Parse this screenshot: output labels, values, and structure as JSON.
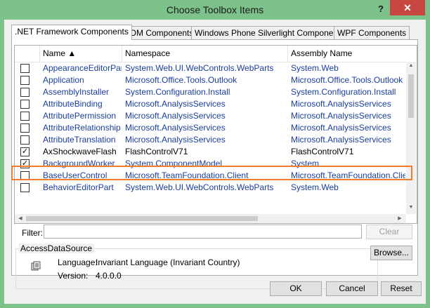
{
  "window": {
    "title": "Choose Toolbox Items",
    "help_label": "?",
    "close_label": "✕"
  },
  "tabs": [
    {
      "label": ".NET Framework Components",
      "active": true
    },
    {
      "label": "COM Components",
      "active": false
    },
    {
      "label": "Windows Phone Silverlight Components",
      "active": false
    },
    {
      "label": "WPF Components",
      "active": false
    }
  ],
  "table": {
    "columns": [
      "Name ▲",
      "Namespace",
      "Assembly Name"
    ],
    "rows": [
      {
        "checked": false,
        "name": "AppearanceEditorPart",
        "namespace": "System.Web.UI.WebControls.WebParts",
        "assembly": "System.Web"
      },
      {
        "checked": false,
        "name": "Application",
        "namespace": "Microsoft.Office.Tools.Outlook",
        "assembly": "Microsoft.Office.Tools.Outlook"
      },
      {
        "checked": false,
        "name": "AssemblyInstaller",
        "namespace": "System.Configuration.Install",
        "assembly": "System.Configuration.Install"
      },
      {
        "checked": false,
        "name": "AttributeBinding",
        "namespace": "Microsoft.AnalysisServices",
        "assembly": "Microsoft.AnalysisServices"
      },
      {
        "checked": false,
        "name": "AttributePermission",
        "namespace": "Microsoft.AnalysisServices",
        "assembly": "Microsoft.AnalysisServices"
      },
      {
        "checked": false,
        "name": "AttributeRelationship",
        "namespace": "Microsoft.AnalysisServices",
        "assembly": "Microsoft.AnalysisServices"
      },
      {
        "checked": false,
        "name": "AttributeTranslation",
        "namespace": "Microsoft.AnalysisServices",
        "assembly": "Microsoft.AnalysisServices"
      },
      {
        "checked": true,
        "name": "AxShockwaveFlash",
        "namespace": "FlashControlV71",
        "assembly": "FlashControlV71"
      },
      {
        "checked": true,
        "name": "BackgroundWorker",
        "namespace": "System.ComponentModel",
        "assembly": "System"
      },
      {
        "checked": false,
        "name": "BaseUserControl",
        "namespace": "Microsoft.TeamFoundation.Client",
        "assembly": "Microsoft.TeamFoundation.Client"
      },
      {
        "checked": false,
        "name": "BehaviorEditorPart",
        "namespace": "System.Web.UI.WebControls.WebParts",
        "assembly": "System.Web"
      }
    ]
  },
  "filter": {
    "label": "Filter:",
    "value": "",
    "clear_label": "Clear"
  },
  "details": {
    "group_title": "AccessDataSource",
    "language_label": "Language:",
    "language_value": "Invariant Language (Invariant Country)",
    "version_label": "Version:",
    "version_value": "4.0.0.0",
    "browse_label": "Browse..."
  },
  "buttons": {
    "ok": "OK",
    "cancel": "Cancel",
    "reset": "Reset"
  },
  "colors": {
    "titlebar": "#7dc28a",
    "close": "#c7463f",
    "highlight": "#f07d2c",
    "link_text": "#1a3e9c"
  }
}
